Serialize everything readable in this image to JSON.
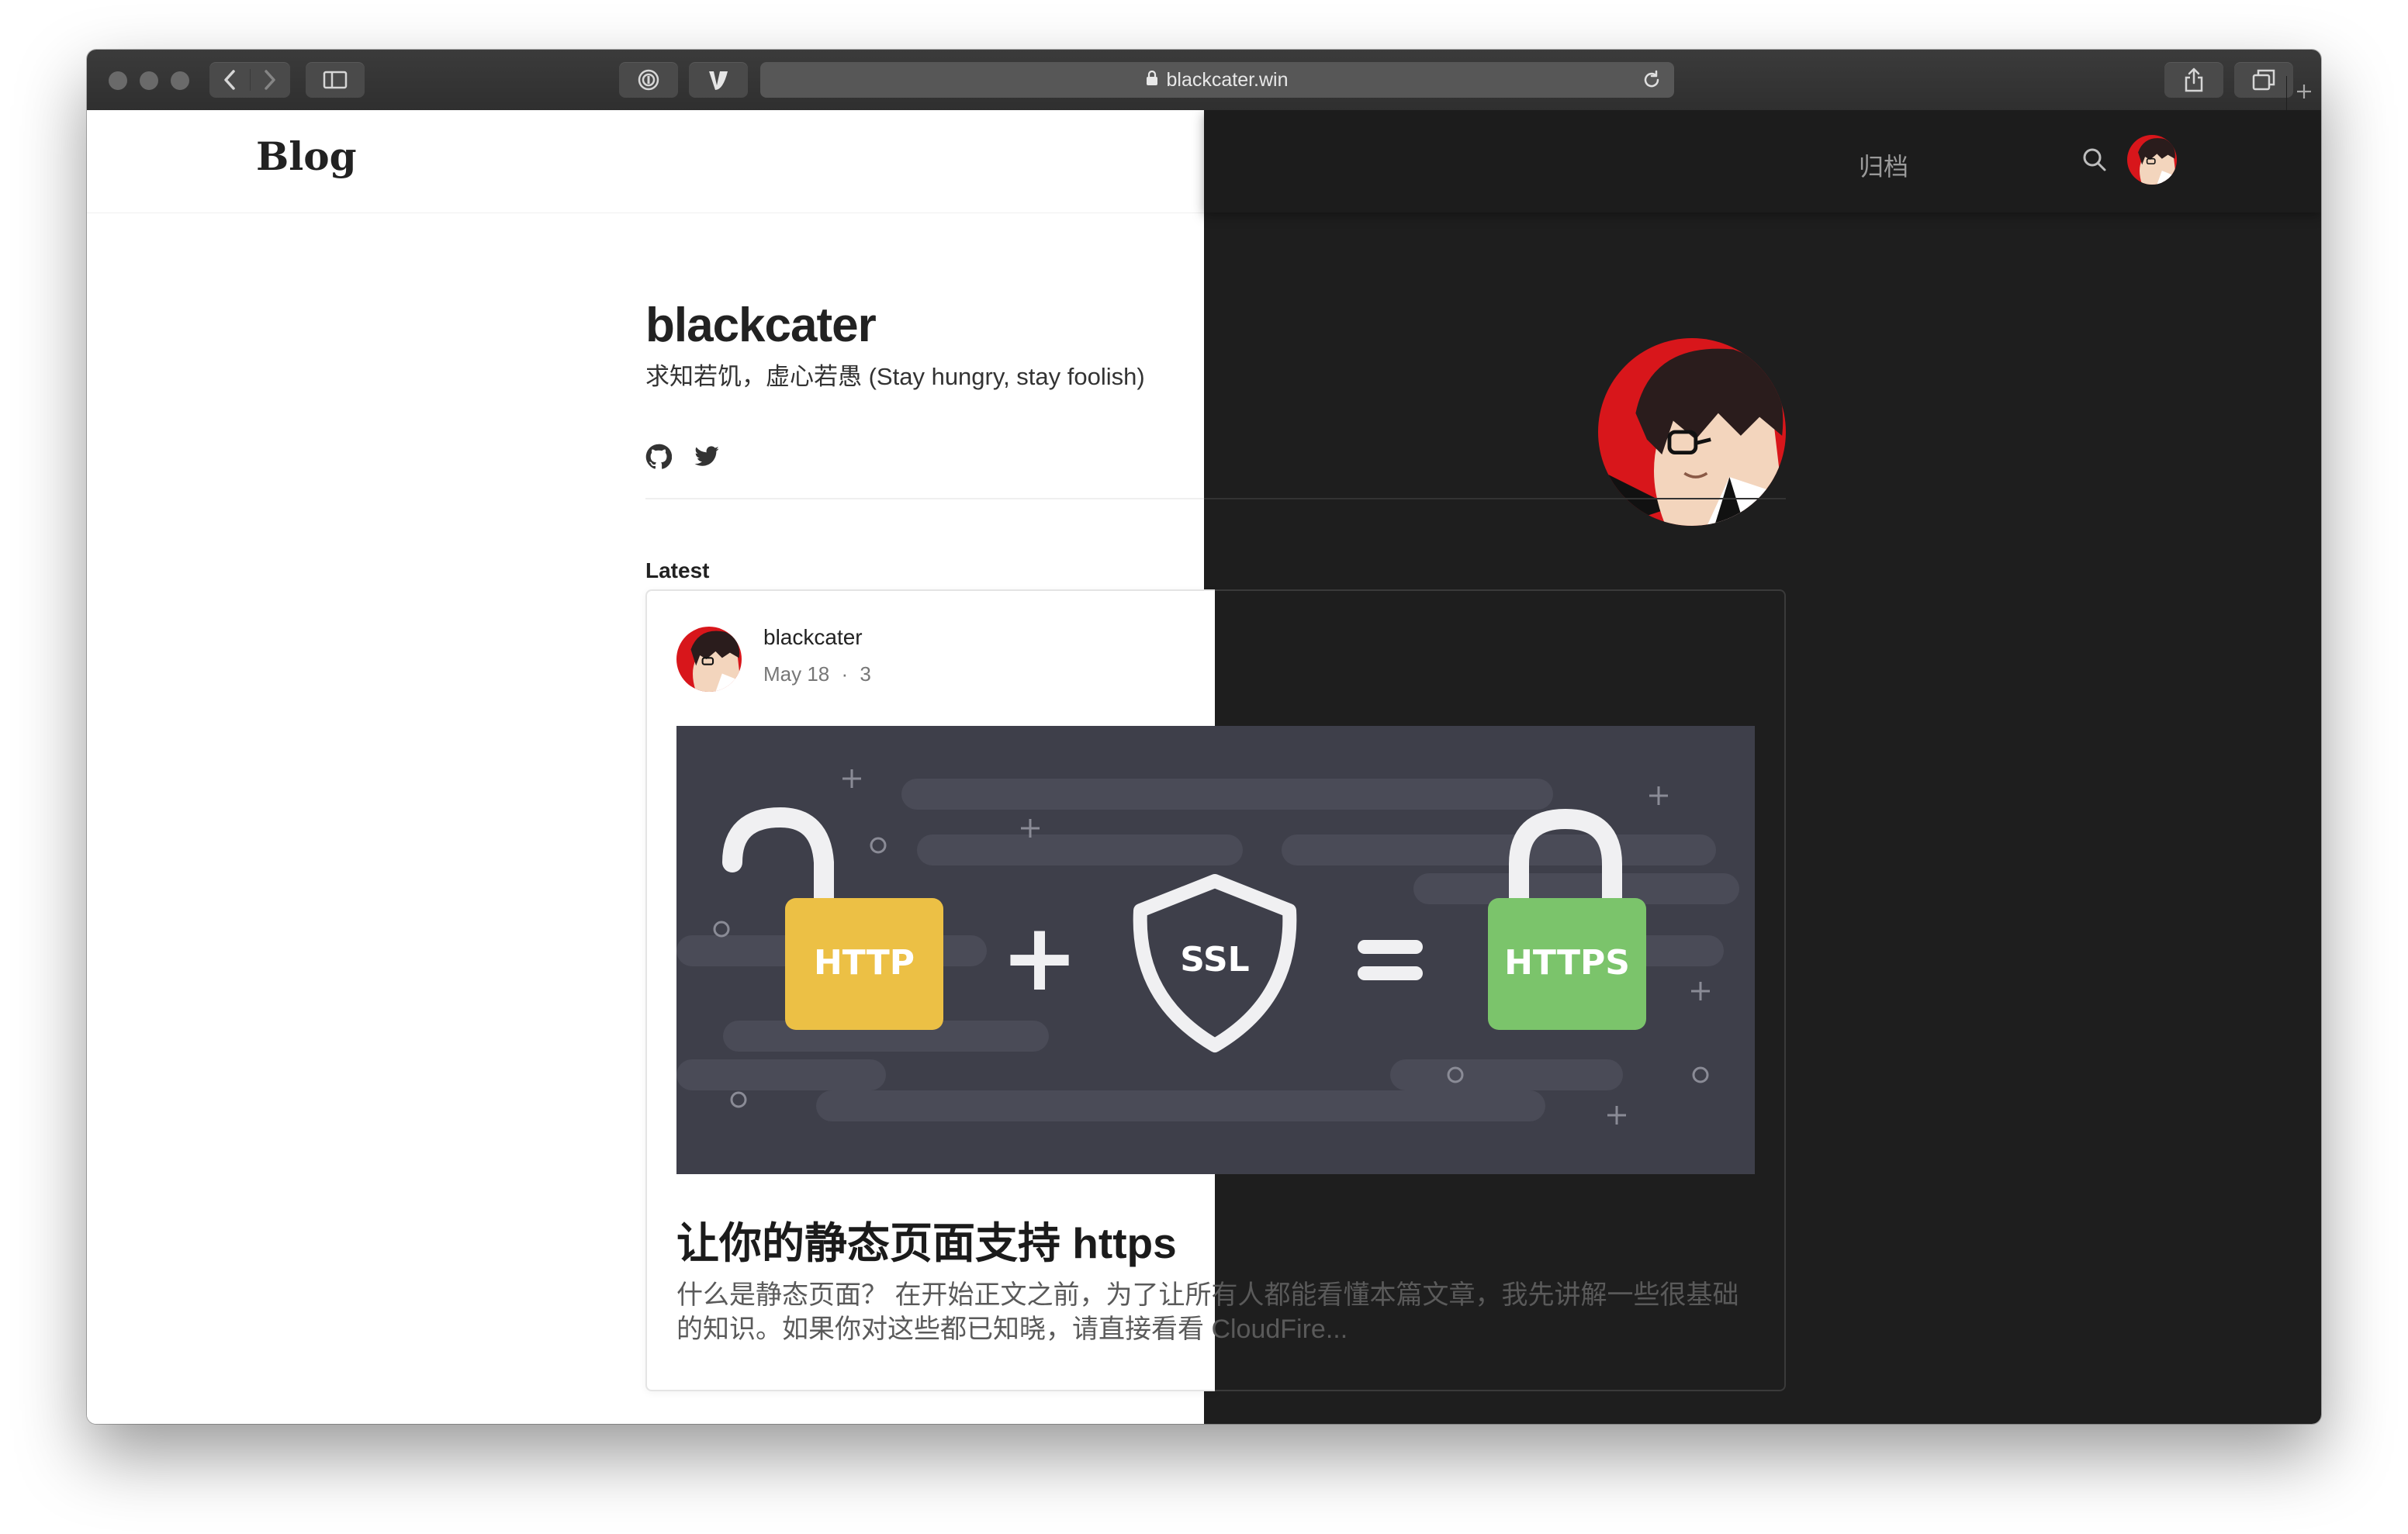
{
  "browser": {
    "url": "blackcater.win",
    "icons": [
      "back-icon",
      "forward-icon",
      "sidebar-icon",
      "password-icon",
      "extension-icon",
      "lock-icon",
      "reload-icon",
      "share-icon",
      "tabs-icon",
      "new-tab-icon"
    ]
  },
  "nav": {
    "brand": "Blog",
    "archive_label": "归档",
    "icons": [
      "search-icon",
      "theme-toggle-icon",
      "avatar"
    ]
  },
  "profile": {
    "name": "blackcater",
    "bio": "求知若饥，虚心若愚 (Stay hungry, stay foolish)",
    "social": [
      "github-icon",
      "twitter-icon"
    ]
  },
  "latest_label": "Latest",
  "post": {
    "author": "blackcater",
    "date": "May 18",
    "separator": "·",
    "count": "3",
    "title": "让你的静态页面支持 https",
    "excerpt": "什么是静态页面？ 在开始正文之前，为了让所有人都能看懂本篇文章，我先讲解一些很基础的知识。如果你对这些都已知晓，请直接看看 CloudFire...",
    "image": {
      "lock_left": "HTTP",
      "plus": "+",
      "shield": "SSL",
      "equals": "=",
      "lock_right": "HTTPS"
    }
  },
  "colors": {
    "http_lock": "#ecc045",
    "https_lock": "#7bc46b",
    "image_bg": "#3e3f4a",
    "dark_bg": "#1e1e1e",
    "avatar_red": "#d8161b"
  }
}
